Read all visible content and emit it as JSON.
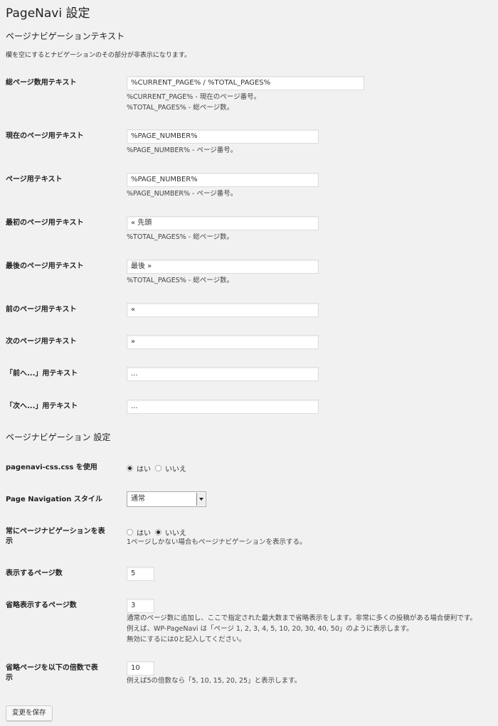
{
  "page_title": "PageNavi 設定",
  "section_text": {
    "heading": "ページナビゲーションテキスト",
    "description": "欄を空にするとナビゲーションのその部分が非表示になります。",
    "fields": [
      {
        "label": "総ページ数用テキスト",
        "value": "%CURRENT_PAGE% / %TOTAL_PAGES%",
        "help": [
          "%CURRENT_PAGE% - 現在のページ番号。",
          "%TOTAL_PAGES% - 総ページ数。"
        ]
      },
      {
        "label": "現在のページ用テキスト",
        "value": "%PAGE_NUMBER%",
        "help": [
          "%PAGE_NUMBER% - ページ番号。"
        ]
      },
      {
        "label": "ページ用テキスト",
        "value": "%PAGE_NUMBER%",
        "help": [
          "%PAGE_NUMBER% - ページ番号。"
        ]
      },
      {
        "label": "最初のページ用テキスト",
        "value": "« 先頭",
        "help": [
          "%TOTAL_PAGES% - 総ページ数。"
        ]
      },
      {
        "label": "最後のページ用テキスト",
        "value": "最後 »",
        "help": [
          "%TOTAL_PAGES% - 総ページ数。"
        ]
      },
      {
        "label": "前のページ用テキスト",
        "value": "«"
      },
      {
        "label": "次のページ用テキスト",
        "value": "»"
      },
      {
        "label": "「前へ...」用テキスト",
        "value": "..."
      },
      {
        "label": "「次へ...」用テキスト",
        "value": "..."
      }
    ]
  },
  "section_settings": {
    "heading": "ページナビゲーション 設定",
    "use_css": {
      "label": "pagenavi-css.css を使用",
      "yes": "はい",
      "no": "いいえ",
      "selected": "yes"
    },
    "style": {
      "label": "Page Navigation スタイル",
      "selected": "通常"
    },
    "always_show": {
      "label_line1": "常にページナビゲーションを表",
      "label_line2": "示",
      "yes": "はい",
      "no": "いいえ",
      "selected": "no",
      "help": "1ページしかない場合もページナビゲーションを表示する。"
    },
    "pages_to_show": {
      "label": "表示するページ数",
      "value": "5"
    },
    "larger_pages": {
      "label": "省略表示するページ数",
      "value": "3",
      "help": [
        "通常のページ数に追加し、ここで指定された最大数まで省略表示をします。非常に多くの投稿がある場合便利です。",
        "例えば、WP-PageNavi は「ページ 1, 2, 3, 4, 5, 10, 20, 30, 40, 50」のように表示します。",
        "無効にするには0と記入してください。"
      ]
    },
    "larger_multiple": {
      "label_line1": "省略ページを以下の倍数で表",
      "label_line2": "示",
      "value": "10",
      "help": "例えば5の倍数なら「5, 10, 15, 20, 25」と表示します。"
    }
  },
  "save_button": "変更を保存"
}
